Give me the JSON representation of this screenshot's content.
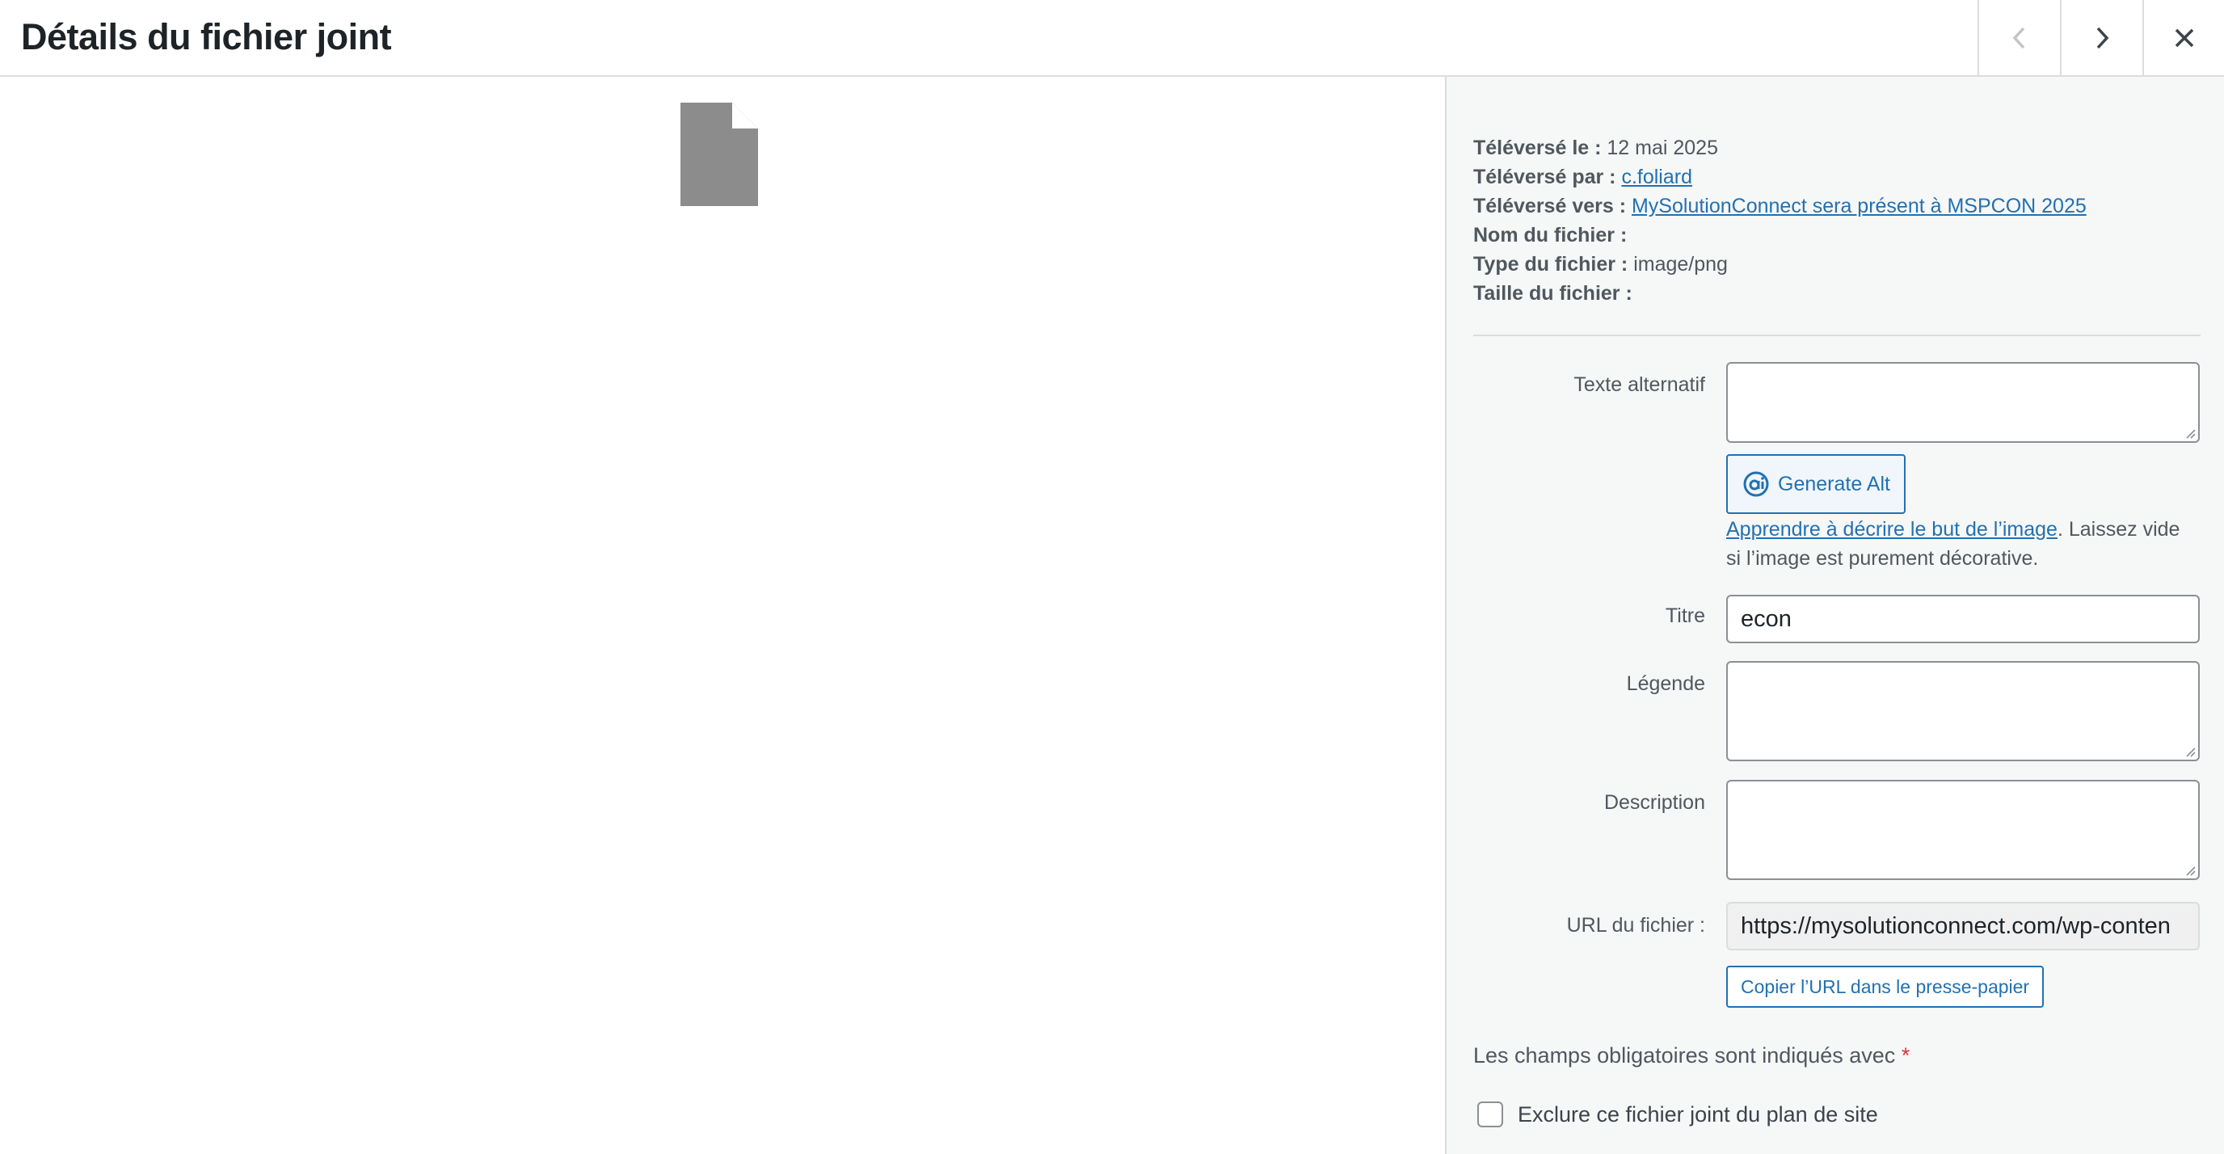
{
  "header": {
    "title": "Détails du fichier joint",
    "prev_icon": "chevron-left-icon",
    "next_icon": "chevron-right-icon",
    "close_icon": "close-icon"
  },
  "preview": {
    "icon": "document-icon",
    "icon_color": "#8c8f94"
  },
  "details": {
    "uploaded_on_label": "Téléversé le :",
    "uploaded_on_value": "12 mai 2025",
    "uploaded_by_label": "Téléversé par :",
    "uploaded_by_value": "c.foliard",
    "uploaded_to_label": "Téléversé vers :",
    "uploaded_to_value": "MySolutionConnect sera présent à MSPCON 2025",
    "file_name_label": "Nom du fichier :",
    "file_type_label": "Type du fichier :",
    "file_type_value": "image/png",
    "file_size_label": "Taille du fichier :"
  },
  "form": {
    "alt_label": "Texte alternatif",
    "alt_value": "",
    "generate_alt_label": "Generate Alt",
    "alt_help_link": "Apprendre à décrire le but de l’image",
    "alt_help_text": ". Laissez vide si l’image est purement décorative.",
    "title_label": "Titre",
    "title_value": "econ",
    "caption_label": "Légende",
    "caption_value": "",
    "description_label": "Description",
    "description_value": "",
    "url_label": "URL du fichier :",
    "url_value": "https://mysolutionconnect.com/wp-conten",
    "copy_url_label": "Copier l’URL dans le presse-papier",
    "required_text": "Les champs obligatoires sont indiqués avec",
    "required_star": "*",
    "exclude_label": "Exclure ce fichier joint du plan de site",
    "exclude_checked": false
  },
  "colors": {
    "accent": "#2271b1",
    "required": "#d63638",
    "sidebar_bg": "#f6f7f7"
  }
}
